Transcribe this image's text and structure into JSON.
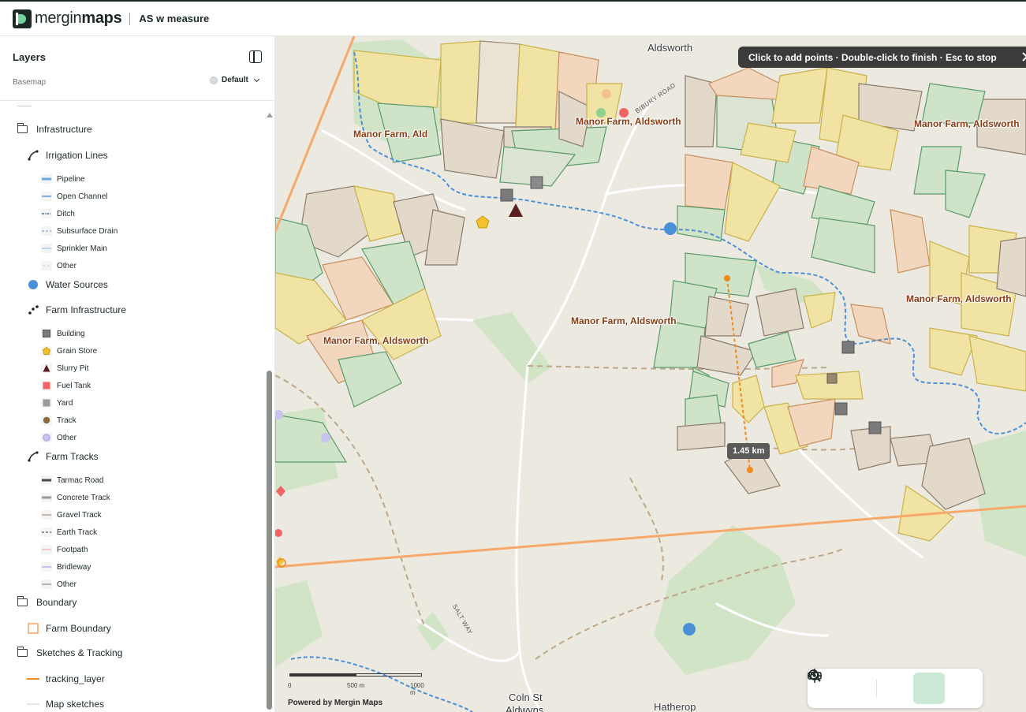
{
  "header": {
    "logo_light": "mergin",
    "logo_bold": "maps",
    "project_title": "AS w measure"
  },
  "sidebar": {
    "title": "Layers",
    "basemap_label": "Basemap",
    "basemap_value": "Default",
    "groups": [
      {
        "label": "Infrastructure"
      },
      {
        "label": "Boundary"
      },
      {
        "label": "Sketches & Tracking"
      }
    ],
    "layers": {
      "irrigation": {
        "label": "Irrigation Lines",
        "items": [
          "Pipeline",
          "Open Channel",
          "Ditch",
          "Subsurface Drain",
          "Sprinkler Main",
          "Other"
        ]
      },
      "water": {
        "label": "Water Sources"
      },
      "farm_infra": {
        "label": "Farm Infrastructure",
        "items": [
          "Building",
          "Grain Store",
          "Slurry Pit",
          "Fuel Tank",
          "Yard",
          "Track",
          "Other"
        ]
      },
      "tracks": {
        "label": "Farm Tracks",
        "items": [
          "Tarmac Road",
          "Concrete Track",
          "Gravel Track",
          "Earth Track",
          "Footpath",
          "Bridleway",
          "Other"
        ]
      },
      "boundary": {
        "label": "Farm Boundary"
      },
      "tracking": {
        "label": "tracking_layer"
      },
      "sketches": {
        "label": "Map sketches"
      }
    }
  },
  "map": {
    "toast": "Click to add points · Double-click to finish · Esc to stop",
    "measure_value": "1.45 km",
    "field_labels": [
      "Manor Farm, Ald",
      "Manor Farm, Aldsworth",
      "Manor Farm, Aldsworth",
      "Manor Farm, Aldsworth",
      "Manor Farm, Aldsworth",
      "Manor Farm, Aldsworth"
    ],
    "places": [
      "Aldsworth",
      "Coln St",
      "Aldwyns",
      "Hatherop"
    ],
    "roads": [
      "BIBURY ROAD",
      "SALT WAY"
    ],
    "scale": {
      "zero": "0",
      "mid": "500 m",
      "end": "1000 m"
    },
    "attribution": "Powered by Mergin Maps"
  },
  "colors": {
    "accent": "#73d19c",
    "measure": "#f08a1a",
    "water": "#4a90d9",
    "tracking": "#f5a96b"
  }
}
